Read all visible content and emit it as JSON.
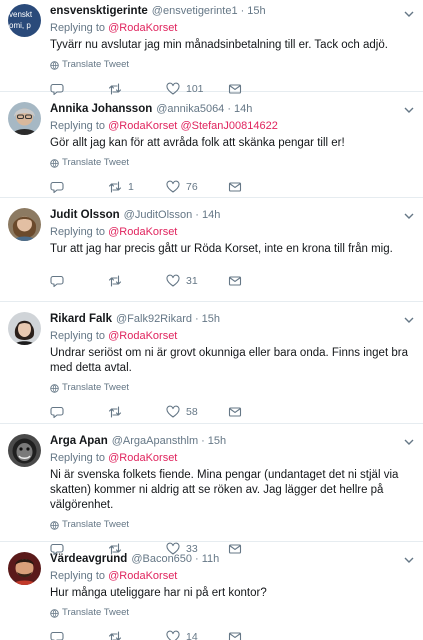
{
  "labels": {
    "replying_to": "Replying to",
    "translate": "Translate Tweet",
    "dot": "·"
  },
  "colors": {
    "mention": "#e0245e",
    "muted": "#657786",
    "border": "#e6ecf0"
  },
  "tweets": [
    {
      "name": "ensvensktigerinte",
      "handle": "@ensvetigerinte1",
      "time": "15h",
      "mentions": [
        "@RodaKorset"
      ],
      "text": "Tyvärr nu avslutar jag min månadsinbetalning till er. Tack och adjö.",
      "replies": "",
      "retweets": "",
      "likes": "101",
      "avatar_text": "venskt\nomi, p"
    },
    {
      "name": "Annika Johansson",
      "handle": "@annika5064",
      "time": "14h",
      "mentions": [
        "@RodaKorset",
        "@StefanJ00814622"
      ],
      "text": "Gör allt jag kan för att avråda folk att skänka pengar till er!",
      "replies": "",
      "retweets": "1",
      "likes": "76"
    },
    {
      "name": "Judit Olsson",
      "handle": "@JuditOlsson",
      "time": "14h",
      "mentions": [
        "@RodaKorset"
      ],
      "text": "Tur att jag har precis gått ur Röda Korset, inte en krona till från mig.",
      "replies": "",
      "retweets": "",
      "likes": "31"
    },
    {
      "name": "Rikard Falk",
      "handle": "@Falk92Rikard",
      "time": "15h",
      "mentions": [
        "@RodaKorset"
      ],
      "text": "Undrar seriöst om ni är grovt okunniga eller bara onda. Finns inget bra med detta avtal.",
      "replies": "",
      "retweets": "",
      "likes": "58"
    },
    {
      "name": "Arga Apan",
      "handle": "@ArgaApansthlm",
      "time": "15h",
      "mentions": [
        "@RodaKorset"
      ],
      "text": "Ni är svenska folkets fiende. Mina pengar (undantaget det ni stjäl via skatten) kommer ni aldrig att se röken av. Jag lägger det hellre på välgörenhet.",
      "replies": "",
      "retweets": "",
      "likes": "33"
    },
    {
      "name": "Värdeavgrund",
      "handle": "@Bacon650",
      "time": "11h",
      "mentions": [
        "@RodaKorset"
      ],
      "text": "Hur många uteliggare har ni på ert kontor?",
      "replies": "",
      "retweets": "",
      "likes": "14"
    }
  ]
}
